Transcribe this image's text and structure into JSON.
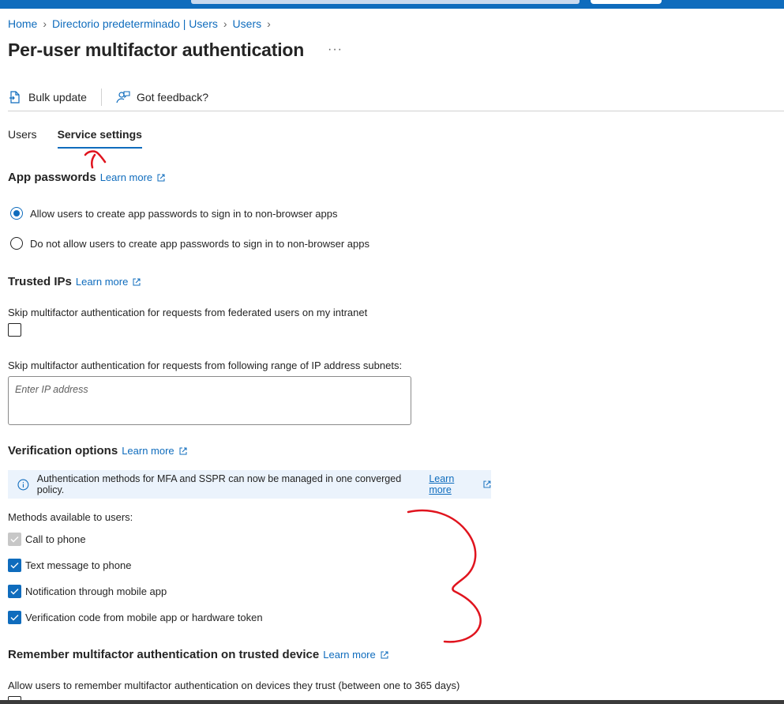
{
  "breadcrumb": {
    "items": [
      "Home",
      "Directorio predeterminado | Users",
      "Users"
    ]
  },
  "page": {
    "title": "Per-user multifactor authentication",
    "more": "···"
  },
  "toolbar": {
    "bulk_update": "Bulk update",
    "feedback": "Got feedback?"
  },
  "tabs": [
    {
      "label": "Users",
      "active": false
    },
    {
      "label": "Service settings",
      "active": true
    }
  ],
  "app_passwords": {
    "heading": "App passwords",
    "learn_more": "Learn more",
    "options": [
      {
        "label": "Allow users to create app passwords to sign in to non-browser apps",
        "selected": true
      },
      {
        "label": "Do not allow users to create app passwords to sign in to non-browser apps",
        "selected": false
      }
    ]
  },
  "trusted_ips": {
    "heading": "Trusted IPs",
    "learn_more": "Learn more",
    "federated_label": "Skip multifactor authentication for requests from federated users on my intranet",
    "federated_checked": false,
    "range_label": "Skip multifactor authentication for requests from following range of IP address subnets:",
    "ip_placeholder": "Enter IP address",
    "ip_value": ""
  },
  "verification": {
    "heading": "Verification options",
    "learn_more": "Learn more",
    "info_text": "Authentication methods for MFA and SSPR can now be managed in one converged policy.",
    "info_link": "Learn more",
    "methods_label": "Methods available to users:",
    "methods": [
      {
        "label": "Call to phone",
        "checked": true,
        "disabled": true
      },
      {
        "label": "Text message to phone",
        "checked": true,
        "disabled": false
      },
      {
        "label": "Notification through mobile app",
        "checked": true,
        "disabled": false
      },
      {
        "label": "Verification code from mobile app or hardware token",
        "checked": true,
        "disabled": false
      }
    ]
  },
  "remember": {
    "heading": "Remember multifactor authentication on trusted device",
    "learn_more": "Learn more",
    "label": "Allow users to remember multifactor authentication on devices they trust (between one to 365 days)"
  },
  "colors": {
    "accent": "#0f6cbd",
    "annotation": "#e0141e",
    "info_bg": "#ebf3fc"
  }
}
